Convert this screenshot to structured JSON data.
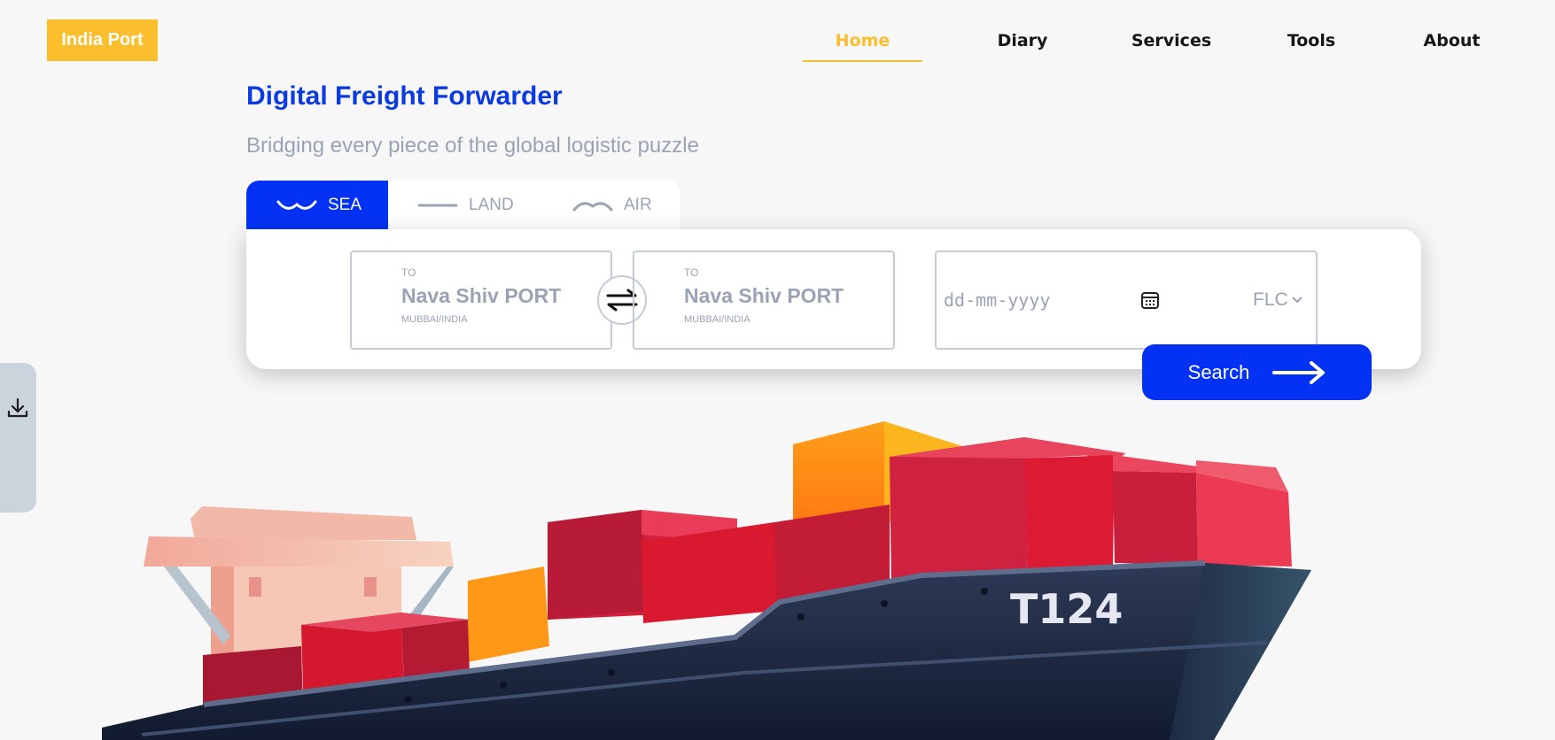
{
  "brand": {
    "logo_text": "India Port"
  },
  "nav": {
    "items": [
      {
        "label": "Home",
        "active": true
      },
      {
        "label": "Diary"
      },
      {
        "label": "Services"
      },
      {
        "label": "Tools"
      },
      {
        "label": "About"
      }
    ]
  },
  "hero": {
    "title": "Digital Freight Forwarder",
    "subtitle": "Bridging every piece of the global logistic puzzle"
  },
  "mode_tabs": [
    {
      "label": "SEA",
      "active": true,
      "icon": "wave-icon"
    },
    {
      "label": "LAND",
      "icon": "line-icon"
    },
    {
      "label": "AIR",
      "icon": "arc-icon"
    }
  ],
  "search_form": {
    "origin": {
      "caption": "TO",
      "port": "Nava Shiv PORT",
      "location": "MUBBAI/INDIA"
    },
    "destination": {
      "caption": "TO",
      "port": "Nava Shiv PORT",
      "location": "MUBBAI/INDIA"
    },
    "date_placeholder": "dd-mm-yyyy",
    "container_type": "FLC",
    "search_label": "Search"
  },
  "illustration": {
    "hull_label": "T124"
  },
  "colors": {
    "brand_yellow": "#fbbf2d",
    "primary_blue": "#0432f5",
    "title_blue": "#0b3be0",
    "muted": "#9aa3b5"
  }
}
